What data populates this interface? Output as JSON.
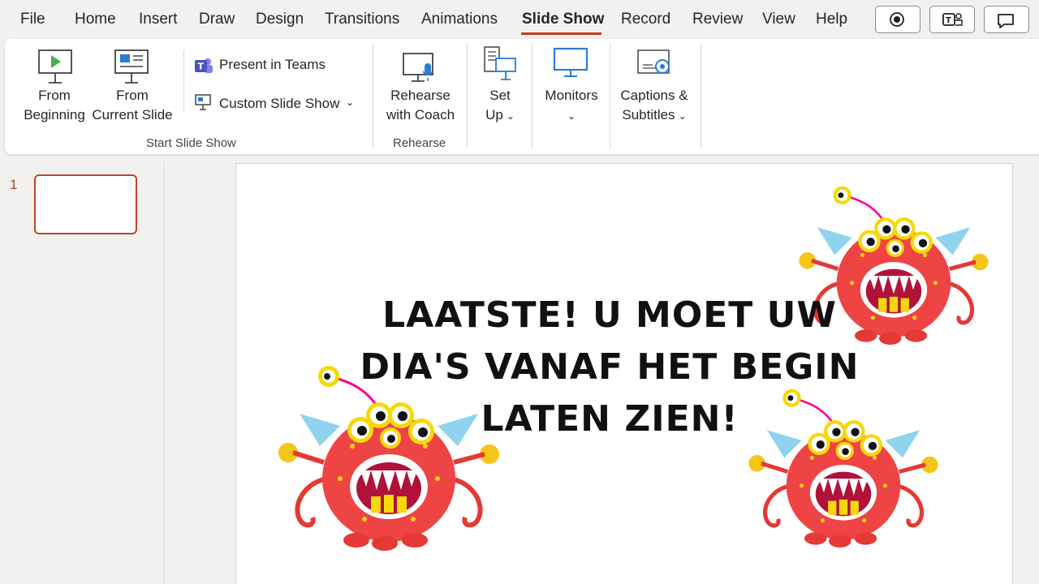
{
  "menu": {
    "tabs": [
      "File",
      "Home",
      "Insert",
      "Draw",
      "Design",
      "Transitions",
      "Animations",
      "Slide Show",
      "Record",
      "Review",
      "View",
      "Help"
    ],
    "active_tab": "Slide Show"
  },
  "ribbon": {
    "from_beginning": [
      "From",
      "Beginning"
    ],
    "from_current": [
      "From",
      "Current Slide"
    ],
    "present_teams": "Present in Teams",
    "custom_slide_show": "Custom Slide Show",
    "start_group_label": "Start Slide Show",
    "rehearse_coach": [
      "Rehearse",
      "with Coach"
    ],
    "rehearse_group_label": "Rehearse",
    "setup": [
      "Set",
      "Up"
    ],
    "monitors": "Monitors",
    "captions": [
      "Captions &",
      "Subtitles"
    ]
  },
  "thumbnails": {
    "slide_number": "1"
  },
  "slide": {
    "text_lines": [
      "LAATSTE! U MOET UW",
      "DIA'S VANAF HET BEGIN",
      "LATEN ZIEN!"
    ]
  },
  "colors": {
    "accent": "#c43e1c",
    "monster_body": "#ef4444",
    "monster_eye_ring": "#f5d90a"
  }
}
